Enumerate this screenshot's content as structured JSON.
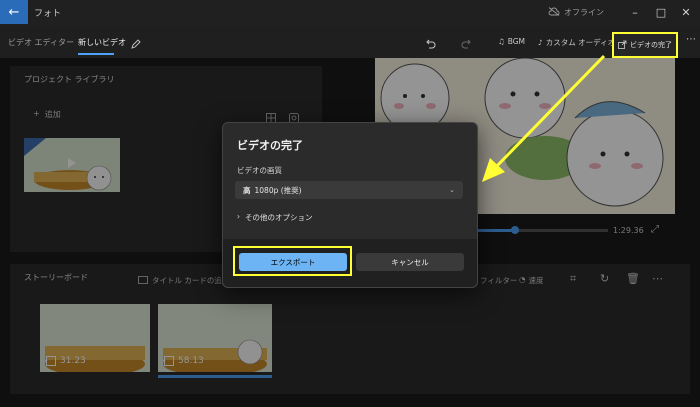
{
  "titlebar": {
    "title": "フォト",
    "offline": "オフライン"
  },
  "tabs": [
    {
      "label": "ビデオ エディター"
    },
    {
      "label": "新しいビデオ"
    }
  ],
  "toolbar": {
    "bgm": "BGM",
    "custom_audio": "カスタム オーディオ",
    "finish_video": "ビデオの完了"
  },
  "library": {
    "title": "プロジェクト ライブラリ",
    "add": "追加"
  },
  "storyboard": {
    "title": "ストーリーボード",
    "add_title_card": "タイトル カードの追加",
    "filter": "フィルター",
    "speed": "速度",
    "clips": [
      {
        "duration": "31.23"
      },
      {
        "duration": "58.13"
      }
    ]
  },
  "player": {
    "time": "1:29.36"
  },
  "dialog": {
    "title": "ビデオの完了",
    "quality_label": "ビデオの画質",
    "quality_badge": "高",
    "quality_value": "1080p (推奨)",
    "more_options": "その他のオプション",
    "export": "エクスポート",
    "cancel": "キャンセル"
  },
  "colors": {
    "accent": "#6db4f5",
    "highlight": "#ffff33",
    "background": "#1a1a1a"
  }
}
